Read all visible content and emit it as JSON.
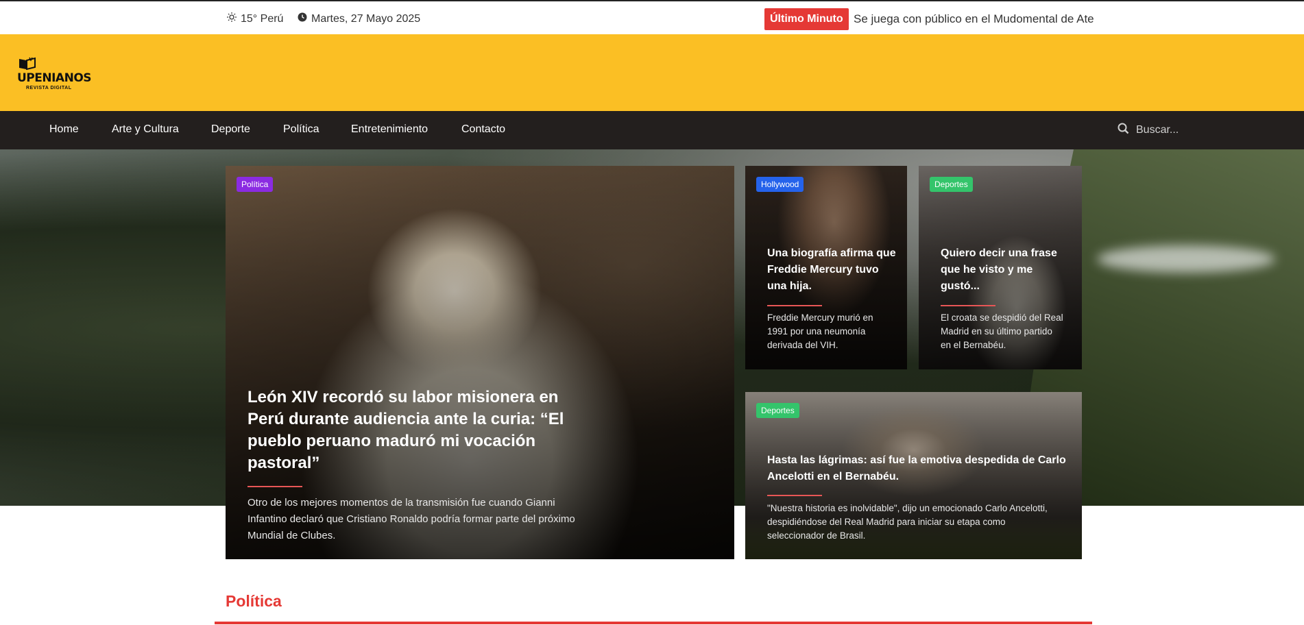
{
  "topbar": {
    "weather": "15° Perú",
    "date": "Martes, 27 Mayo 2025",
    "breaking_label": "Último Minuto",
    "breaking_text": "Se juega con público en el Mudomental de Ate"
  },
  "logo": {
    "name": "UPENIANOS",
    "tagline": "REVISTA DIGITAL"
  },
  "nav": {
    "items": [
      "Home",
      "Arte y Cultura",
      "Deporte",
      "Política",
      "Entretenimiento",
      "Contacto"
    ],
    "search_placeholder": "Buscar..."
  },
  "featured": {
    "main": {
      "category": "Política",
      "title": "León XIV recordó su labor misionera en Perú durante audiencia ante la curia: “El pueblo peruano maduró mi vocación pastoral”",
      "excerpt": "Otro de los mejores momentos de la transmisión fue cuando Gianni Infantino declaró que Cristiano Ronaldo podría formar parte del próximo Mundial de Clubes."
    },
    "side1": {
      "category": "Hollywood",
      "title": "Una biografía afirma que Freddie Mercury tuvo una hija.",
      "excerpt": "Freddie Mercury murió en 1991 por una neumonía derivada del VIH."
    },
    "side2": {
      "category": "Deportes",
      "title": "Quiero decir una frase que he visto y me gustó...",
      "excerpt": "El croata se despidió del Real Madrid en su último partido en el Bernabéu."
    },
    "wide": {
      "category": "Deportes",
      "title": "Hasta las lágrimas: así fue la emotiva despedida de Carlo Ancelotti en el Bernabéu.",
      "excerpt": "\"Nuestra historia es inolvidable\", dijo un emocionado Carlo Ancelotti, despidiéndose del Real Madrid para iniciar su etapa como seleccionador de Brasil."
    }
  },
  "section": {
    "title": "Política"
  },
  "colors": {
    "header_yellow": "#fbbf24",
    "nav_dark": "#231f1e",
    "accent_red": "#e53935",
    "politica_purple": "#8b2be2",
    "hollywood_blue": "#2563eb",
    "deportes_green": "#34c46b"
  }
}
